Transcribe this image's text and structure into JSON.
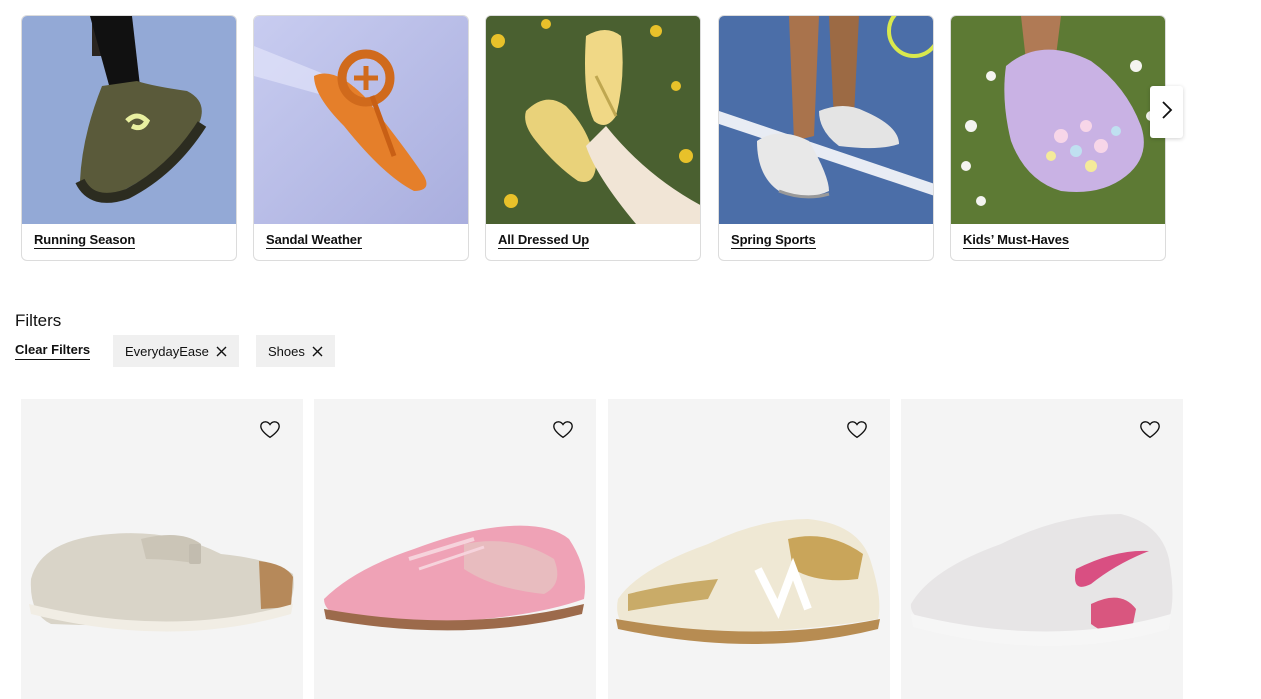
{
  "categories": [
    {
      "label": "Running Season"
    },
    {
      "label": "Sandal Weather"
    },
    {
      "label": "All Dressed Up"
    },
    {
      "label": "Spring Sports"
    },
    {
      "label": "Kids’ Must-Haves"
    }
  ],
  "carousel": {
    "next_icon": "chevron-right-icon"
  },
  "filters": {
    "title": "Filters",
    "clear_label": "Clear Filters",
    "active": [
      {
        "label": "EverydayEase"
      },
      {
        "label": "Shoes"
      }
    ]
  },
  "products": [
    {
      "name": "suede-clog",
      "favorite_icon": "heart-outline-icon"
    },
    {
      "name": "pink-mesh-sneaker",
      "favorite_icon": "heart-outline-icon"
    },
    {
      "name": "cream-tan-sneaker",
      "favorite_icon": "heart-outline-icon"
    },
    {
      "name": "white-pink-swoosh-sneaker",
      "favorite_icon": "heart-outline-icon"
    }
  ]
}
